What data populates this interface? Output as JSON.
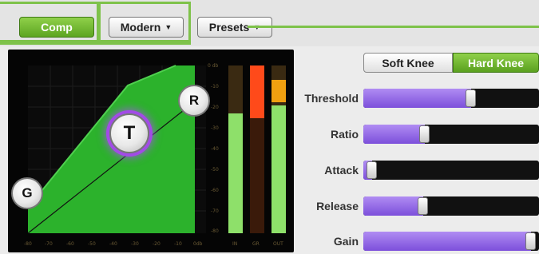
{
  "toolbar": {
    "comp_label": "Comp",
    "mode_label": "Modern",
    "presets_label": "Presets"
  },
  "graph": {
    "handles": {
      "gate": "G",
      "threshold": "T",
      "ratio": "R"
    },
    "db_scale": [
      "0 db",
      "-10",
      "-20",
      "-30",
      "-40",
      "-50",
      "-60",
      "-70",
      "-80"
    ],
    "x_scale": [
      "-80",
      "-70",
      "-60",
      "-50",
      "-40",
      "-30",
      "-20",
      "-10",
      "0db"
    ],
    "meter_labels": [
      "IN",
      "GR",
      "OUT"
    ],
    "meters": {
      "in": 0.78,
      "gr": 0.27,
      "out": 0.82
    },
    "colors": {
      "curve_fill": "#2cb22c",
      "meter_green": "#8ee06a",
      "meter_red": "#ff4a1a",
      "meter_amber": "#f0a010"
    }
  },
  "knee": {
    "soft_label": "Soft Knee",
    "hard_label": "Hard Knee",
    "selected": "Hard Knee"
  },
  "params": {
    "threshold": {
      "label": "Threshold",
      "value": 0.62
    },
    "ratio": {
      "label": "Ratio",
      "value": 0.34
    },
    "attack": {
      "label": "Attack",
      "value": 0.02
    },
    "release": {
      "label": "Release",
      "value": 0.33
    },
    "gain": {
      "label": "Gain",
      "value": 0.98
    }
  },
  "accent": "#7ec24a",
  "slider_color": "#8a5de6"
}
